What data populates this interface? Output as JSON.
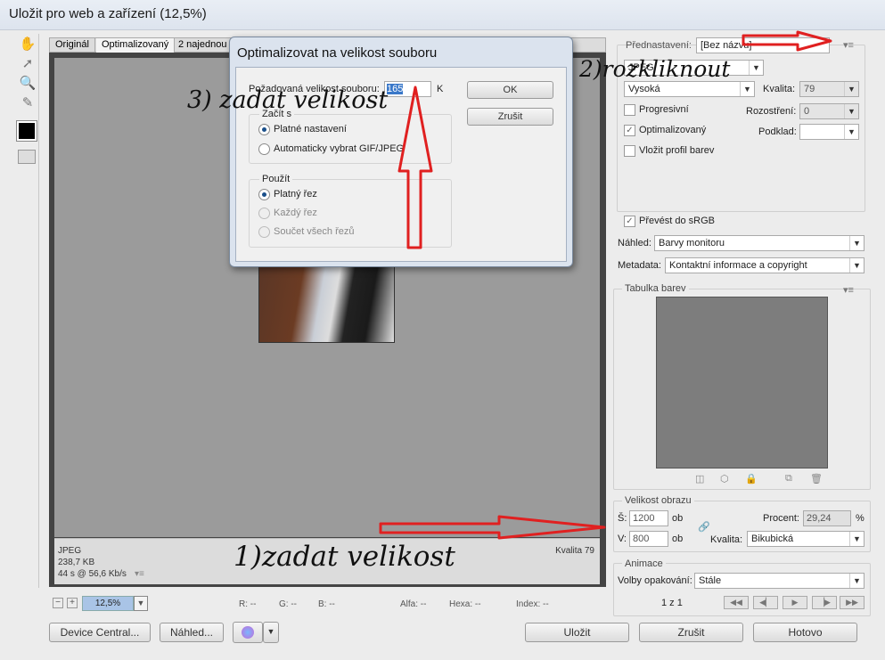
{
  "window": {
    "title": "Uložit pro web a zařízení (12,5%)"
  },
  "tools": [
    "hand-icon",
    "slice-select-icon",
    "zoom-icon",
    "eyedropper-icon"
  ],
  "view_tabs": [
    "Originál",
    "Optimalizovaný",
    "2 najednou"
  ],
  "info": {
    "format": "JPEG",
    "size": "238,7 KB",
    "time": "44 s @ 56,6 Kb/s",
    "menu_glyph": "▾≡",
    "quality": "Kvalita 79"
  },
  "bottom_bar": {
    "zoom": "12,5%",
    "r": "R: --",
    "g": "G: --",
    "b": "B: --",
    "alpha": "Alfa: --",
    "hex": "Hexa: --",
    "index": "Index: --"
  },
  "footer_buttons": {
    "device_central": "Device Central...",
    "preview": "Náhled...",
    "save": "Uložit",
    "cancel": "Zrušit",
    "done": "Hotovo"
  },
  "settings": {
    "preset_label": "Přednastavení:",
    "preset_value": "[Bez názvu]",
    "format_value": "JPEG",
    "quality_level": "Vysoká",
    "quality_label": "Kvalita:",
    "quality_value": "79",
    "progressive_label": "Progresivní",
    "blur_label": "Rozostření:",
    "blur_value": "0",
    "optimized_label": "Optimalizovaný",
    "matte_label": "Podklad:",
    "embed_profile_label": "Vložit profil barev",
    "convert_srgb_label": "Převést do sRGB",
    "preview_label": "Náhled:",
    "preview_value": "Barvy monitoru",
    "metadata_label": "Metadata:",
    "metadata_value": "Kontaktní informace a copyright"
  },
  "color_table": {
    "title": "Tabulka barev"
  },
  "image_size": {
    "title": "Velikost obrazu",
    "w_label": "Š:",
    "w_value": "1200",
    "h_label": "V:",
    "h_value": "800",
    "unit": "ob",
    "percent_label": "Procent:",
    "percent_value": "29,24",
    "percent_unit": "%",
    "quality_label": "Kvalita:",
    "quality_value": "Bikubická"
  },
  "animation": {
    "title": "Animace",
    "loop_label": "Volby opakování:",
    "loop_value": "Stále",
    "frame": "1 z 1"
  },
  "dialog": {
    "title": "Optimalizovat na velikost souboru",
    "size_label": "Požadovaná velikost souboru:",
    "size_value": "165",
    "size_unit": "K",
    "ok": "OK",
    "cancel": "Zrušit",
    "start_group": "Začít s",
    "start_current": "Platné nastavení",
    "start_auto": "Automaticky vybrat GIF/JPEG",
    "use_group": "Použít",
    "use_current": "Platný řez",
    "use_each": "Každý řez",
    "use_total": "Součet všech řezů"
  },
  "annotations": {
    "step1": "1)zadat  velikost",
    "step2": "2)rozkliknout",
    "step3": "3) zadat velikost"
  },
  "colors": {
    "arrow": "#e02020",
    "selection": "#3a78c9",
    "canvas": "#9b9b9b"
  }
}
